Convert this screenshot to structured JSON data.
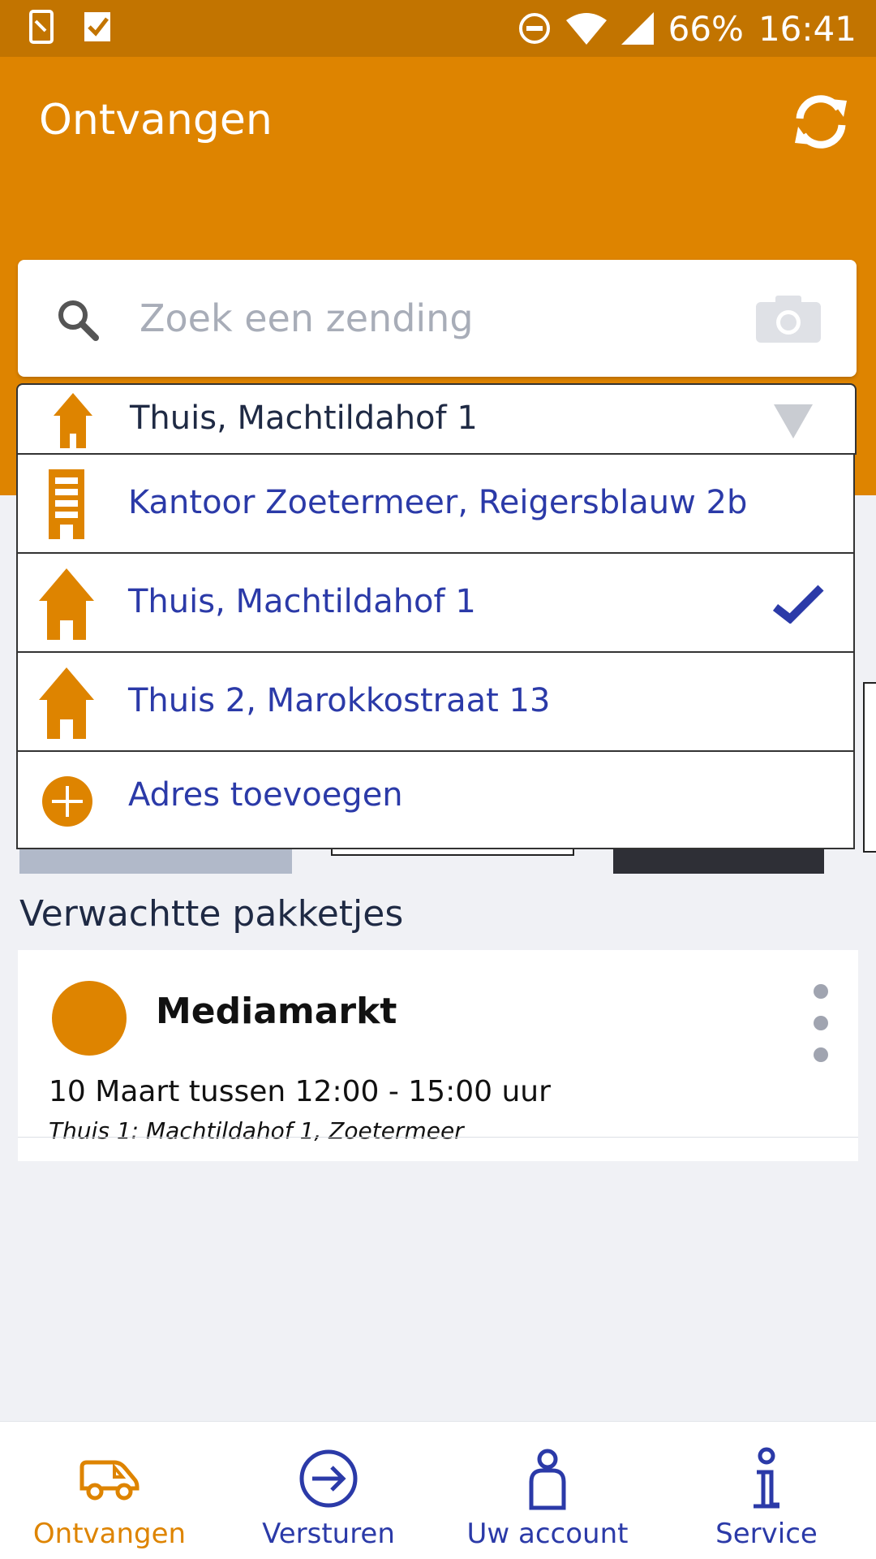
{
  "statusbar": {
    "battery": "66%",
    "time": "16:41"
  },
  "header": {
    "title": "Ontvangen"
  },
  "search": {
    "placeholder": "Zoek een zending"
  },
  "dropdown": {
    "selected": "Thuis, Machtildahof 1",
    "items": [
      {
        "label": "Kantoor Zoetermeer, Reigersblauw 2b",
        "icon": "office-building-icon",
        "selected": false
      },
      {
        "label": "Thuis, Machtildahof 1",
        "icon": "house-icon",
        "selected": true
      },
      {
        "label": "Thuis 2, Marokkostraat 13",
        "icon": "house-icon",
        "selected": false
      },
      {
        "label": "Adres toevoegen",
        "icon": "plus-circle-icon",
        "selected": false
      }
    ]
  },
  "expected": {
    "section_title": "Verwachtte pakketjes",
    "cards": [
      {
        "name": "Mediamarkt",
        "date": "10 Maart tussen 12:00 - 15:00 uur",
        "address": "Thuis 1: Machtildahof 1, Zoetermeer"
      }
    ]
  },
  "bottomnav": {
    "items": [
      {
        "label": "Ontvangen",
        "icon": "delivery-van-icon",
        "active": true
      },
      {
        "label": "Versturen",
        "icon": "send-arrow-icon",
        "active": false
      },
      {
        "label": "Uw account",
        "icon": "account-icon",
        "active": false
      },
      {
        "label": "Service",
        "icon": "info-icon",
        "active": false
      }
    ]
  },
  "colors": {
    "brand_orange": "#de8400",
    "status_orange": "#c27400",
    "link_blue": "#2b3aa8"
  }
}
